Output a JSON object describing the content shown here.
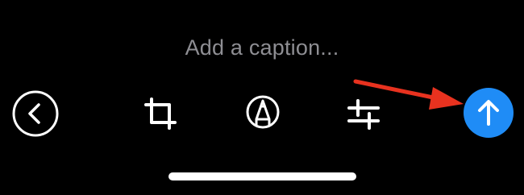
{
  "caption": {
    "placeholder": "Add a caption..."
  },
  "toolbar": {
    "items": [
      {
        "name": "back",
        "icon": "chevron-left-icon"
      },
      {
        "name": "crop",
        "icon": "crop-icon"
      },
      {
        "name": "markup",
        "icon": "markup-pen-icon"
      },
      {
        "name": "adjust",
        "icon": "sliders-icon"
      },
      {
        "name": "send",
        "icon": "arrow-up-icon"
      }
    ]
  },
  "annotation": {
    "icon": "red-arrow-icon",
    "color": "#e8321f"
  },
  "colors": {
    "background": "#000000",
    "placeholder_text": "#8e8e93",
    "send_button": "#1f8cf6",
    "icons": "#ffffff"
  }
}
